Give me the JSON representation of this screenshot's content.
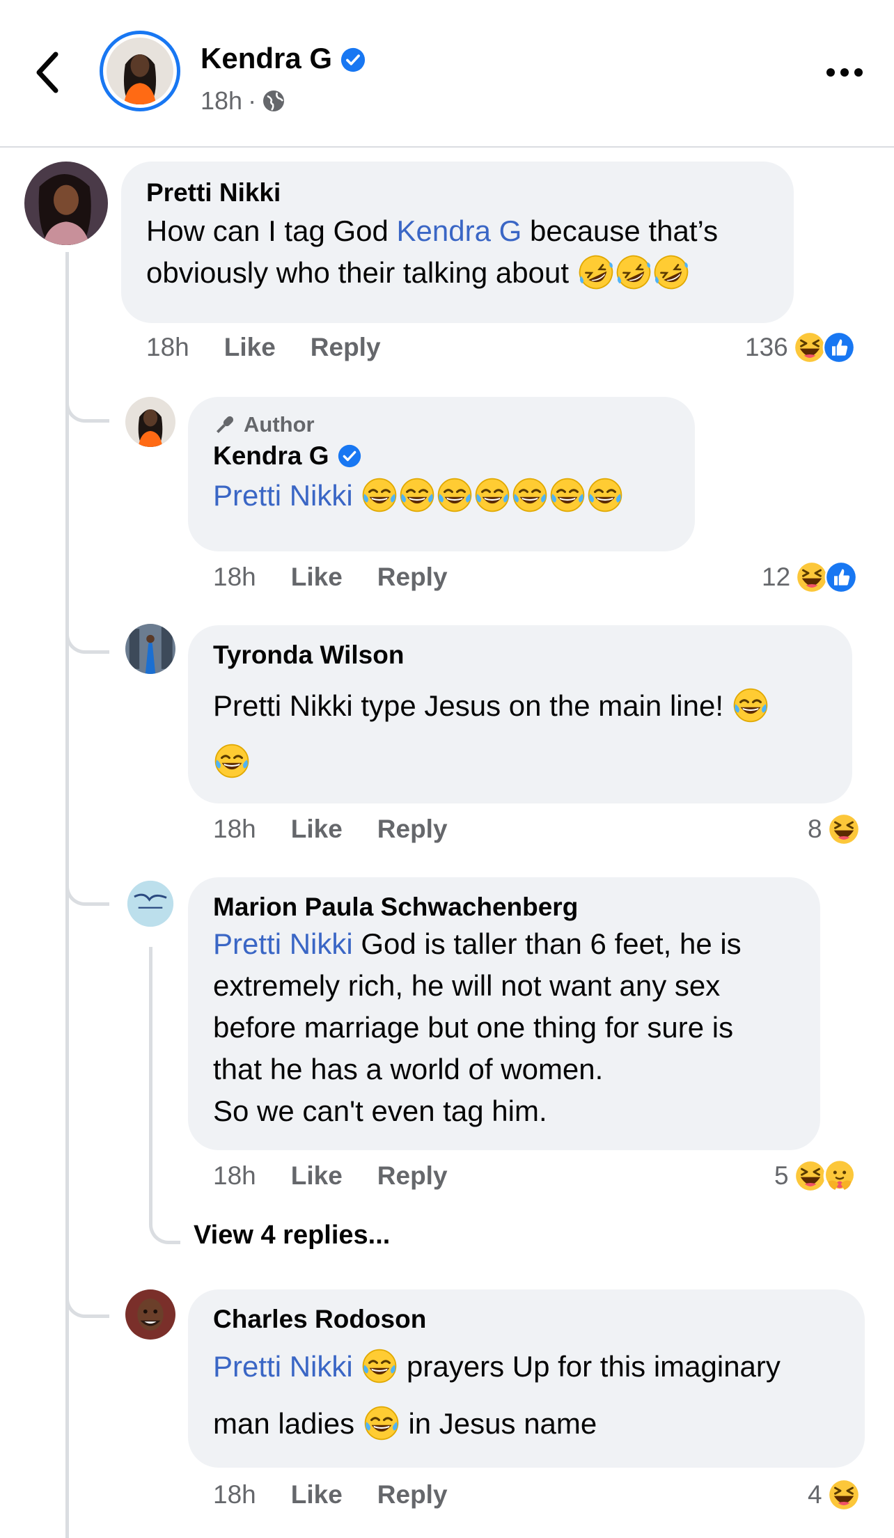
{
  "header": {
    "name": "Kendra G",
    "time": "18h",
    "separator": "·"
  },
  "comments": [
    {
      "author": "Pretti Nikki",
      "text_before": "How can I tag God ",
      "mention": "Kendra G",
      "text_after_1": " because that’s",
      "text_line2": "obviously who their talking about ",
      "time": "18h",
      "like": "Like",
      "reply": "Reply",
      "reaction_count": "136"
    },
    {
      "author_tag": "Author",
      "author": "Kendra G",
      "mention": "Pretti Nikki",
      "time": "18h",
      "like": "Like",
      "reply": "Reply",
      "reaction_count": "12"
    },
    {
      "author": "Tyronda Wilson",
      "text": "Pretti Nikki type Jesus on the main line! ",
      "time": "18h",
      "like": "Like",
      "reply": "Reply",
      "reaction_count": "8"
    },
    {
      "author": "Marion Paula Schwachenberg",
      "mention": "Pretti Nikki",
      "line1": " God is taller than 6 feet, he is",
      "line2": "extremely rich, he will not want any sex",
      "line3": "before marriage but one thing for sure is",
      "line4": "that he has a world of women.",
      "line5": "So we can't even tag him.",
      "time": "18h",
      "like": "Like",
      "reply": "Reply",
      "reaction_count": "5",
      "view_replies": "View 4 replies..."
    },
    {
      "author": "Charles Rodoson",
      "mention": "Pretti Nikki",
      "line1": " prayers Up for this imaginary",
      "line2_a": "man ladies ",
      "line2_b": " in Jesus name",
      "time": "18h",
      "like": "Like",
      "reply": "Reply",
      "reaction_count": "4"
    }
  ],
  "colors": {
    "brand_blue": "#1877f2",
    "mention": "#3a66c5",
    "bubble": "#f0f2f5",
    "secondary_text": "#65676b"
  }
}
